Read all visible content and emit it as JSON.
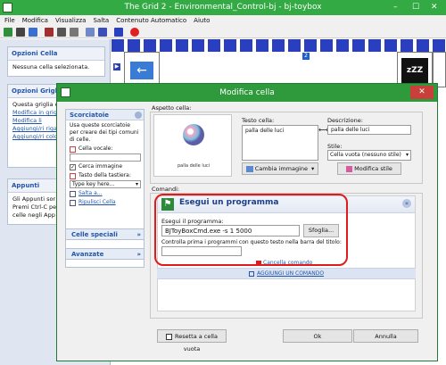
{
  "window": {
    "title": "The Grid 2 - Environmental_Control-bj - bj-toybox",
    "minimize": "–",
    "maximize": "☐",
    "close": "✕"
  },
  "menu": [
    "File",
    "Modifica",
    "Visualizza",
    "Salta",
    "Contenuto Automatico",
    "Aiuto"
  ],
  "left_panel": {
    "cell_options": {
      "title": "Opzioni Cella",
      "text": "Nessuna cella selezionata."
    },
    "grid_options": {
      "title": "Opzioni Griglia",
      "intro": "Questa griglia c",
      "items": [
        "Modifica in griglia",
        "Modifica li",
        "Aggiungi/ri riga",
        "Aggiungi/ri colonna"
      ]
    },
    "notes": {
      "title": "Appunti",
      "lines": [
        "Gli Appunti sor",
        "Premi Ctrl-C pe",
        "celle negli App"
      ]
    }
  },
  "grid": {
    "markers": [
      "X",
      "2"
    ],
    "colors": {
      "strip": "#2a3ec0",
      "marker_red": "#d42020",
      "marker_blue": "#1b5fd0"
    }
  },
  "dialog": {
    "title": "Modifica cella",
    "close": "✕",
    "shortcuts": {
      "title": "Scorciatoie",
      "description": "Usa queste scorciatoie per creare dei tipi comuni di celle.",
      "vocal_cell_label": "Cella vocale:",
      "search_image_label": "Cerca immagine",
      "keyboard_key_label": "Tasto della tastiera:",
      "keyboard_key_placeholder": "Type key here...",
      "jump_link": "Salta a...",
      "clear_link": "Ripulisci Cella"
    },
    "special_cells": "Celle speciali",
    "advanced": "Avanzate",
    "appearance": {
      "group_label": "Aspetto cella:",
      "preview_caption": "palla delle luci",
      "cell_text_label": "Testo cella:",
      "cell_text_value": "palla delle luci",
      "description_label": "Descrizione:",
      "description_value": "palla delle luci",
      "style_label": "Stile:",
      "style_value": "Cella vuota (nessuno stile)",
      "change_image_button": "Cambia immagine",
      "edit_style_button": "Modifica stile"
    },
    "commands": {
      "group_label": "Comandi:",
      "command_title": "Esegui un programma",
      "run_label": "Esegui il programma:",
      "run_value": "BJToyBoxCmd.exe -s 1 5000",
      "browse_button": "Sfoglia...",
      "check_label": "Controlla prima i programmi con questo testo nella barra del titolo:",
      "delete_command": "Cancella comando",
      "add_command": "AGGIUNGI UN COMANDO"
    },
    "footer": {
      "reset_label": "Resetta a cella vuota",
      "ok_button": "Ok",
      "cancel_button": "Annulla"
    }
  }
}
